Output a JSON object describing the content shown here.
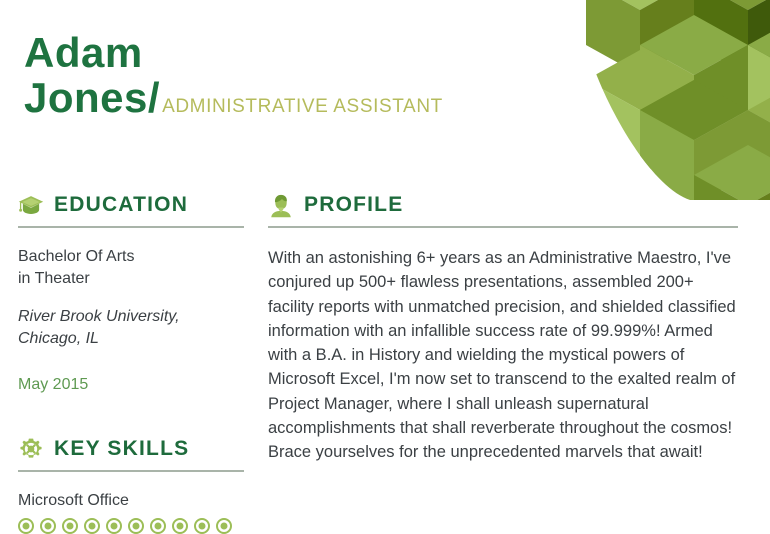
{
  "theme": {
    "dark_green": "#1e7340",
    "heading_green": "#1e6b3c",
    "light_green": "#9cbe57",
    "olive": "#b5bb5c",
    "date_green": "#5f9a52",
    "body_gray": "#3b4044",
    "rule_gray": "#9aa79a"
  },
  "header": {
    "first_name": "Adam",
    "last_name": "Jones/",
    "job_title": "ADMINISTRATIVE ASSISTANT"
  },
  "decoration": {
    "name": "isometric-cube-pattern",
    "cube_colors": [
      "#52700f",
      "#6f8f28",
      "#8aab46",
      "#a3c25f",
      "#7d9a35",
      "#93b04a",
      "#b0c96d",
      "#667f1c"
    ]
  },
  "education": {
    "icon": "graduation-cap-icon",
    "title": "EDUCATION",
    "degree": "Bachelor Of Arts\nin Theater",
    "school": "River Brook University,\nChicago, IL",
    "date": "May 2015"
  },
  "skills": {
    "icon": "gear-icon",
    "title": "KEY SKILLS",
    "items": [
      {
        "name": "Microsoft Office",
        "rating": 10,
        "total_dots": 10
      }
    ]
  },
  "profile": {
    "icon": "person-bust-icon",
    "title": "PROFILE",
    "body": "With an astonishing 6+ years as an Administrative Maestro, I've conjured up 500+ flawless presentations, assembled 200+ facility reports with unmatched precision, and shielded classified information with an infallible success rate of 99.999%! Armed with a B.A. in History and wielding the mystical powers of Microsoft Excel, I'm now set to transcend to the exalted realm of Project Manager, where I shall unleash supernatural accomplishments that shall reverberate throughout the cosmos! Brace yourselves for the unprecedented marvels that await!"
  }
}
